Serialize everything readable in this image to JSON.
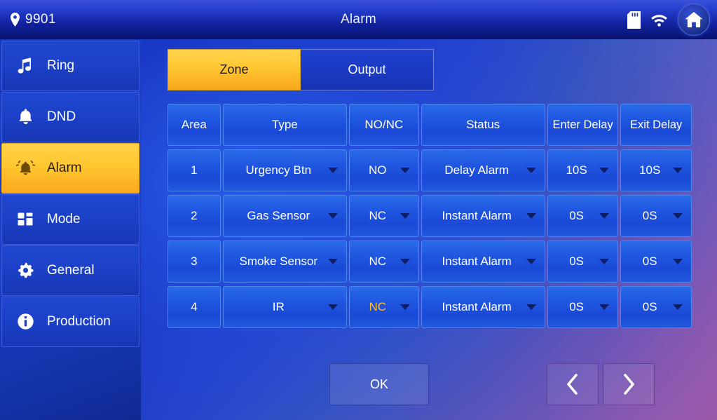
{
  "topbar": {
    "location_icon": "location-pin-icon",
    "device_id": "9901",
    "title": "Alarm",
    "sd_icon": "sd-card-icon",
    "wifi_icon": "wifi-icon",
    "home_icon": "home-icon"
  },
  "sidebar": {
    "items": [
      {
        "label": "Ring",
        "icon": "music-note-icon",
        "active": false
      },
      {
        "label": "DND",
        "icon": "bell-icon",
        "active": false
      },
      {
        "label": "Alarm",
        "icon": "alarm-bell-icon",
        "active": true
      },
      {
        "label": "Mode",
        "icon": "grid-icon",
        "active": false
      },
      {
        "label": "General",
        "icon": "gear-icon",
        "active": false
      },
      {
        "label": "Production",
        "icon": "info-icon",
        "active": false
      }
    ]
  },
  "main": {
    "tabs": [
      {
        "label": "Zone",
        "active": true
      },
      {
        "label": "Output",
        "active": false
      }
    ],
    "table": {
      "headers": [
        "Area",
        "Type",
        "NO/NC",
        "Status",
        "Enter Delay",
        "Exit Delay"
      ],
      "rows": [
        {
          "area": "1",
          "type": "Urgency Btn",
          "nonc": "NO",
          "nonc_highlight": false,
          "status": "Delay Alarm",
          "enter_delay": "10S",
          "exit_delay": "10S"
        },
        {
          "area": "2",
          "type": "Gas Sensor",
          "nonc": "NC",
          "nonc_highlight": false,
          "status": "Instant Alarm",
          "enter_delay": "0S",
          "exit_delay": "0S"
        },
        {
          "area": "3",
          "type": "Smoke Sensor",
          "nonc": "NC",
          "nonc_highlight": false,
          "status": "Instant Alarm",
          "enter_delay": "0S",
          "exit_delay": "0S"
        },
        {
          "area": "4",
          "type": "IR",
          "nonc": "NC",
          "nonc_highlight": true,
          "status": "Instant Alarm",
          "enter_delay": "0S",
          "exit_delay": "0S"
        }
      ]
    },
    "footer": {
      "ok_label": "OK",
      "prev_icon": "chevron-left-icon",
      "next_icon": "chevron-right-icon"
    }
  },
  "colors": {
    "accent": "#ffc630",
    "warn_text": "#ffc22e",
    "cell_blue": "#1f56e0",
    "sidebar_blue": "#1c41c8"
  }
}
